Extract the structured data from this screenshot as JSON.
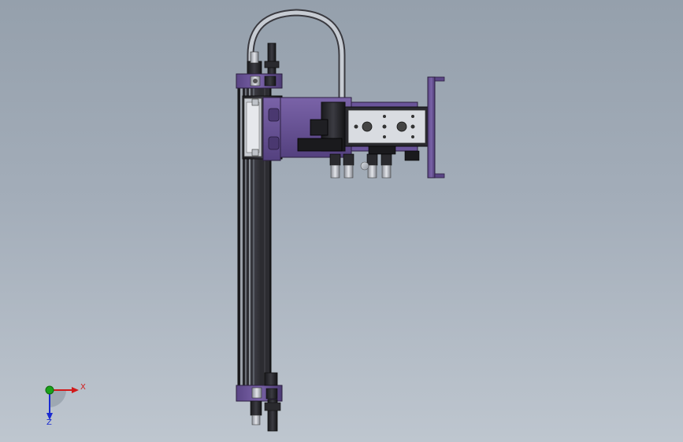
{
  "view": {
    "colors": {
      "background_top": "#95a0ac",
      "background_bottom": "#bec6cf",
      "part_purple": "#6b5497",
      "part_dark": "#2a2a2e",
      "part_steel": "#b8bcc4",
      "axis_x": "#d11a1a",
      "axis_y": "#1aa11a",
      "axis_z": "#1a2ad1"
    }
  },
  "triad": {
    "x_label": "X",
    "z_label": "Z",
    "icons": [
      "x-axis-arrow-icon",
      "y-axis-dot-icon",
      "z-axis-arrow-icon"
    ]
  }
}
